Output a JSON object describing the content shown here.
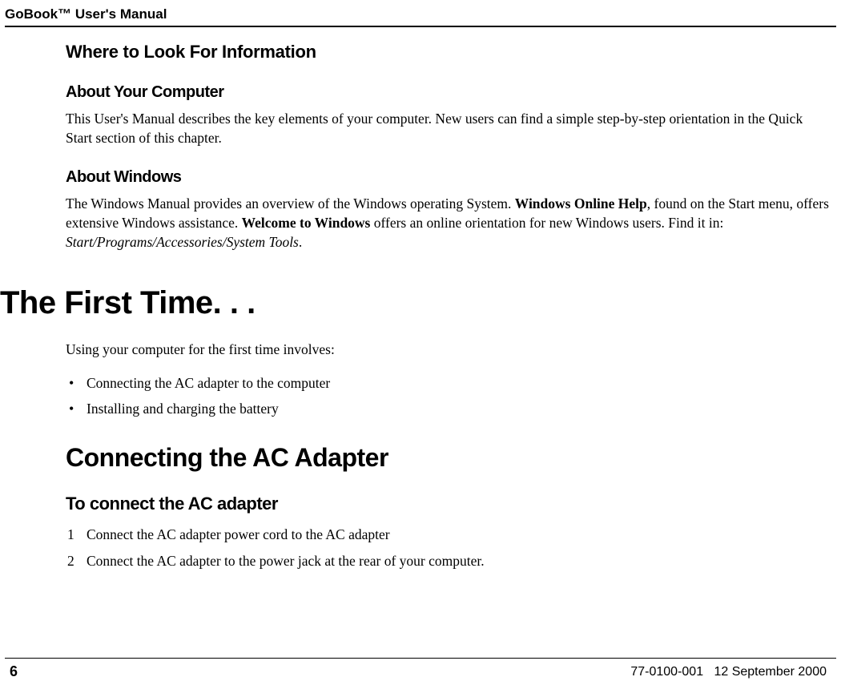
{
  "header": {
    "title": "GoBook™ User's Manual"
  },
  "section1": {
    "heading": "Where to Look For Information",
    "sub1": {
      "heading": "About Your Computer",
      "text": "This User's Manual describes the key elements of your computer. New users can find a simple step-by-step orientation in the Quick Start section of this chapter."
    },
    "sub2": {
      "heading": "About Windows",
      "text_part1": "The Windows Manual provides an overview of the Windows operating System. ",
      "text_bold1": "Windows Online Help",
      "text_part2": ", found on the Start menu, offers extensive Windows assistance. ",
      "text_bold2": "Welcome to Windows",
      "text_part3": " offers an online orientation for new Windows users. Find it in:  ",
      "text_italic": "Start/Programs/Accessories/System Tools",
      "text_end": "."
    }
  },
  "section2": {
    "heading": "The First Time. . .",
    "intro": "Using your computer for the first time involves:",
    "bullets": [
      "Connecting the AC adapter to the computer",
      "Installing and charging the battery"
    ],
    "sub1": {
      "heading": "Connecting the AC Adapter",
      "subheading": "To connect the AC adapter",
      "steps": [
        "Connect the AC adapter power cord to the AC adapter",
        "Connect the AC adapter to the power jack at the rear of your computer."
      ]
    }
  },
  "footer": {
    "page": "6",
    "docnum": "77-0100-001",
    "date": "12 September 2000"
  }
}
